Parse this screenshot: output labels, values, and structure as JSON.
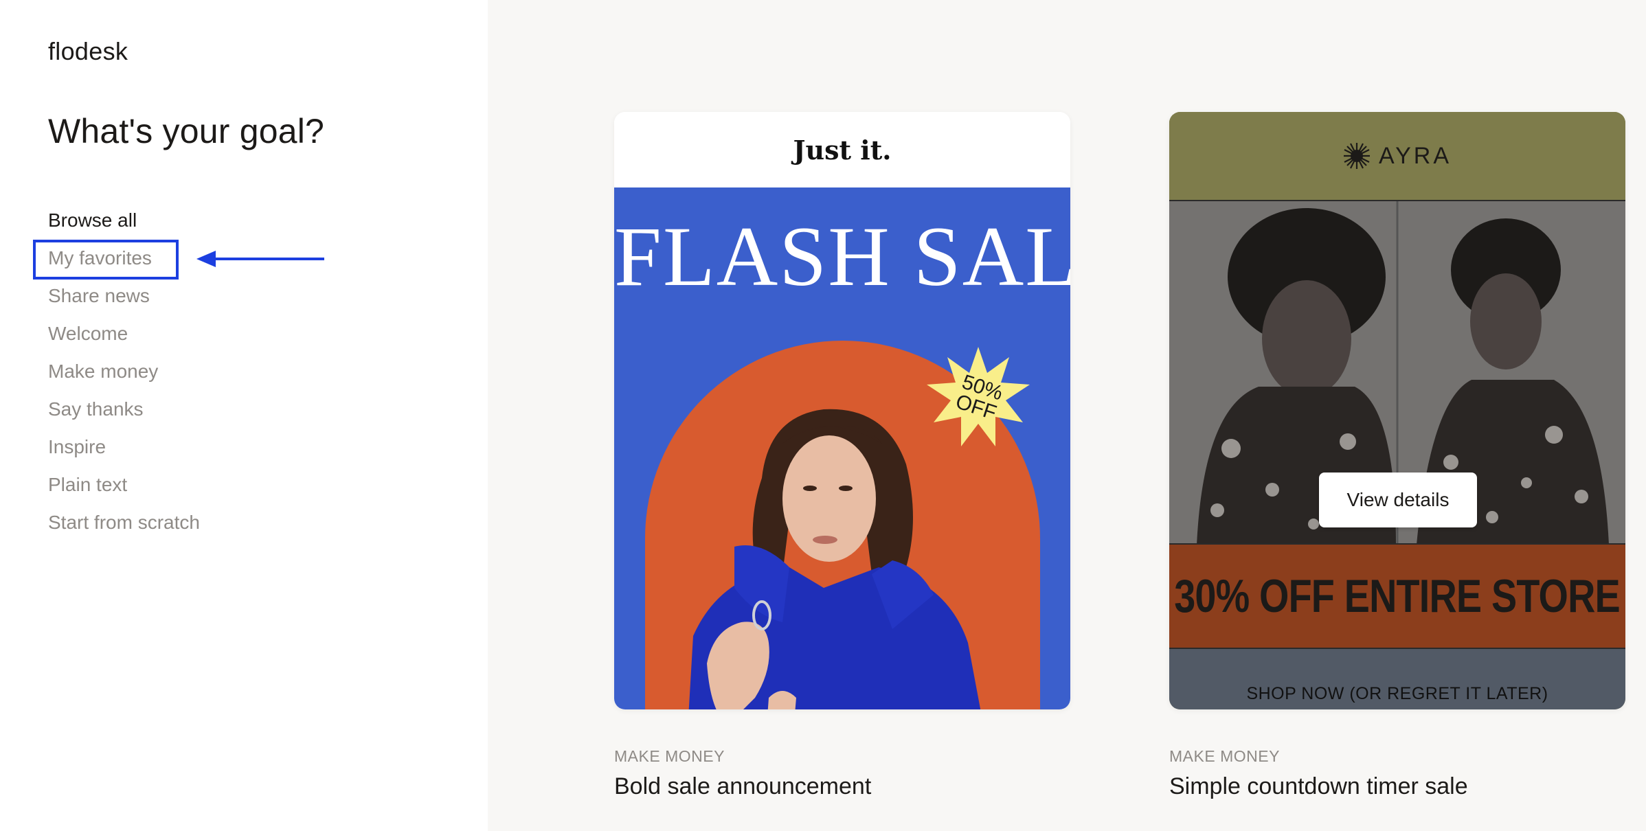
{
  "brand": {
    "name": "flodesk"
  },
  "sidebar": {
    "heading": "What's your goal?",
    "items": [
      {
        "label": "Browse all",
        "active": true
      },
      {
        "label": "My favorites",
        "active": false
      },
      {
        "label": "Share news",
        "active": false
      },
      {
        "label": "Welcome",
        "active": false
      },
      {
        "label": "Make money",
        "active": false
      },
      {
        "label": "Say thanks",
        "active": false
      },
      {
        "label": "Inspire",
        "active": false
      },
      {
        "label": "Plain text",
        "active": false
      },
      {
        "label": "Start from scratch",
        "active": false
      }
    ]
  },
  "annotation": {
    "color": "#1c3fe0",
    "target": "My favorites"
  },
  "templates": [
    {
      "category": "MAKE MONEY",
      "title": "Bold sale announcement",
      "preview": {
        "brand": "Just it.",
        "headline": "FLASH SALE",
        "badge_line1": "50%",
        "badge_line2": "OFF",
        "bg_color": "#3b5fcc",
        "arch_color": "#d85b2f"
      }
    },
    {
      "category": "MAKE MONEY",
      "title": "Simple countdown timer sale",
      "preview": {
        "brand": "AYRA",
        "promo": "30% OFF ENTIRE STORE",
        "cta": "SHOP NOW (OR REGRET IT LATER)",
        "header_color": "#7e7c4b",
        "promo_color": "#8c3e1c",
        "footer_color": "#525a66"
      },
      "hover_button": "View details"
    }
  ]
}
